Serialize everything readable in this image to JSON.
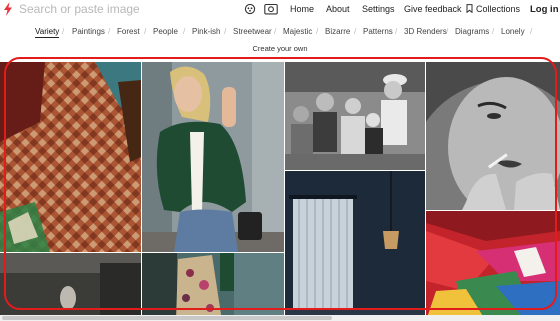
{
  "header": {
    "search_placeholder": "Search or paste image",
    "nav": {
      "home": "Home",
      "about": "About",
      "settings": "Settings",
      "feedback": "Give feedback",
      "collections": "Collections",
      "login": "Log in"
    }
  },
  "categories": [
    "Variety",
    "Paintings",
    "Forest",
    "People",
    "Pink-ish",
    "Streetwear",
    "Majestic",
    "Bizarre",
    "Patterns",
    "3D Renders",
    "Diagrams",
    "Lonely"
  ],
  "create_label": "Create your own",
  "colors": {
    "highlight": "#e21b1b",
    "accent": "#e8323c"
  }
}
